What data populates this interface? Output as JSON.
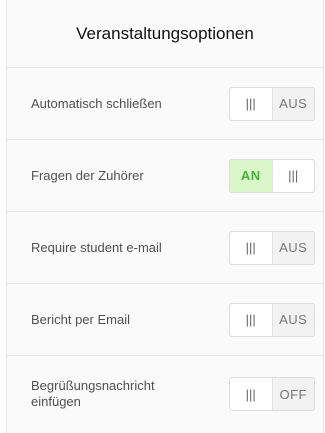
{
  "header": {
    "title": "Veranstaltungsoptionen"
  },
  "options": [
    {
      "label": "Automatisch schließen",
      "state_label": "AUS",
      "grip": "|||",
      "on": false
    },
    {
      "label": "Fragen der Zuhörer",
      "state_label": "AN",
      "grip": "|||",
      "on": true
    },
    {
      "label": "Require student e-mail",
      "state_label": "AUS",
      "grip": "|||",
      "on": false
    },
    {
      "label": "Bericht per Email",
      "state_label": "AUS",
      "grip": "|||",
      "on": false
    },
    {
      "label": "Begrüßungsnachricht einfügen",
      "state_label": "OFF",
      "grip": "|||",
      "on": false
    }
  ],
  "colors": {
    "on_background": "#d9f7c9",
    "on_text": "#45b335",
    "off_background": "#f2f2f2"
  },
  "icons": {
    "grip": "grip-handle-icon"
  }
}
